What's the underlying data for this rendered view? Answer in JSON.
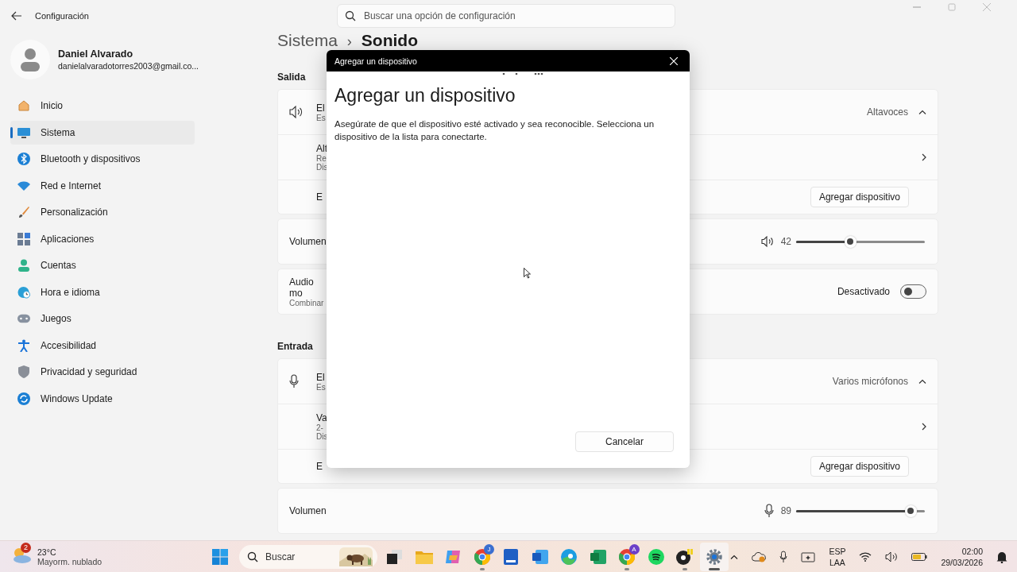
{
  "window": {
    "title": "Configuración"
  },
  "search": {
    "placeholder": "Buscar una opción de configuración"
  },
  "user": {
    "name": "Daniel Alvarado",
    "email": "danielalvaradotorres2003@gmail.co..."
  },
  "nav": [
    {
      "label": "Inicio",
      "selected": false
    },
    {
      "label": "Sistema",
      "selected": true
    },
    {
      "label": "Bluetooth y dispositivos",
      "selected": false
    },
    {
      "label": "Red e Internet",
      "selected": false
    },
    {
      "label": "Personalización",
      "selected": false
    },
    {
      "label": "Aplicaciones",
      "selected": false
    },
    {
      "label": "Cuentas",
      "selected": false
    },
    {
      "label": "Hora e idioma",
      "selected": false
    },
    {
      "label": "Juegos",
      "selected": false
    },
    {
      "label": "Accesibilidad",
      "selected": false
    },
    {
      "label": "Privacidad y seguridad",
      "selected": false
    },
    {
      "label": "Windows Update",
      "selected": false
    }
  ],
  "breadcrumb": [
    "Sistema",
    "›",
    "Sonido"
  ],
  "sections": [
    {
      "label": "Salida",
      "cards": [
        {
          "rows": [
            {
              "kind": "device-header",
              "title": "El",
              "lines": [
                "Es"
              ],
              "value": "Altavoces",
              "expanded": true
            },
            {
              "kind": "device",
              "title": "Alt",
              "lines": [
                "Re",
                "Dis"
              ]
            },
            {
              "kind": "action",
              "title": "E",
              "button": "Agregar dispositivo"
            }
          ]
        },
        {
          "rows": [
            {
              "kind": "volume",
              "title": "Volumen",
              "reading": "42",
              "level": 0.42
            }
          ]
        },
        {
          "rows": [
            {
              "kind": "toggle",
              "title": "Audio mo",
              "lines": [
                "Combinar"
              ],
              "state": "Desactivado",
              "on": false
            }
          ]
        }
      ]
    },
    {
      "label": "Entrada",
      "cards": [
        {
          "rows": [
            {
              "kind": "device-header",
              "title": "El",
              "lines": [
                "Es"
              ],
              "value": "Varios micrófonos",
              "expanded": true
            },
            {
              "kind": "device",
              "title": "Va",
              "lines": [
                "2-",
                "Dis"
              ]
            },
            {
              "kind": "action",
              "title": "E",
              "button": "Agregar dispositivo"
            }
          ]
        },
        {
          "rows": [
            {
              "kind": "volume",
              "title": "Volumen",
              "reading": "89",
              "level": 0.89
            }
          ]
        }
      ]
    }
  ],
  "dialog": {
    "title": "Agregar un dispositivo",
    "heading": "Agregar un dispositivo",
    "text": "Asegúrate de que el dispositivo esté activado y sea reconocible. Selecciona un dispositivo de la lista para conectarte.",
    "button": "Cancelar"
  },
  "taskbar": {
    "weather": {
      "badge": "2",
      "temp": "23°C",
      "desc": "Mayorm. nublado"
    },
    "search": {
      "placeholder": "Buscar"
    },
    "apps": [
      {
        "running": false,
        "selected": false
      },
      {
        "running": false,
        "selected": false
      },
      {
        "running": false,
        "selected": false
      },
      {
        "running": true,
        "selected": false,
        "badge": "J"
      },
      {
        "running": false,
        "selected": false
      },
      {
        "running": false,
        "selected": false
      },
      {
        "running": false,
        "selected": false
      },
      {
        "running": false,
        "selected": false
      },
      {
        "running": true,
        "selected": false,
        "badge": "A"
      },
      {
        "running": false,
        "selected": false
      },
      {
        "running": true,
        "selected": false
      },
      {
        "running": true,
        "selected": true
      }
    ],
    "language": [
      "ESP",
      "LAA"
    ],
    "time": "02:00",
    "date": "29/03/2026"
  }
}
